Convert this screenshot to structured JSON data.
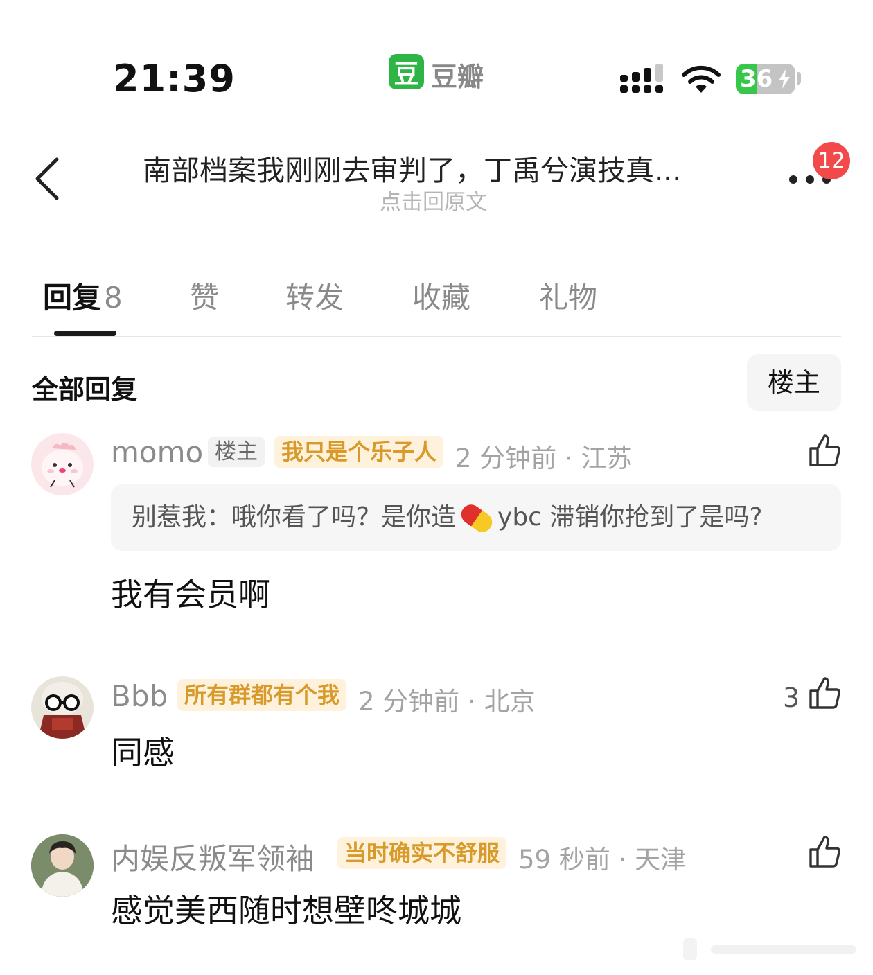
{
  "status_bar": {
    "time": "21:39",
    "app_logo_char": "豆",
    "app_name": "豆瓣",
    "battery": "36",
    "battery_level_percent": 36,
    "icons": [
      "signal-icon",
      "wifi-icon",
      "battery-charging-icon"
    ]
  },
  "nav": {
    "title": "南部档案我刚刚去审判了，丁禹兮演技真...",
    "subtitle": "点击回原文",
    "badge": "12",
    "icons": [
      "back-chevron-icon",
      "more-dots-icon"
    ]
  },
  "tabs": [
    {
      "label": "回复",
      "count": "8",
      "active": true
    },
    {
      "label": "赞"
    },
    {
      "label": "转发"
    },
    {
      "label": "收藏"
    },
    {
      "label": "礼物"
    }
  ],
  "section": {
    "title": "全部回复",
    "filter_label": "楼主"
  },
  "comments": [
    {
      "username": "momo",
      "op_tag": "楼主",
      "group_tag": "我只是个乐子人",
      "meta": "2 分钟前 · 江苏",
      "quote_prefix": "别惹我：哦你看了吗？是你造",
      "quote_suffix": "ybc 滞销你抢到了是吗?",
      "text": "我有会员啊",
      "likes": ""
    },
    {
      "username": "Bbb",
      "group_tag": "所有群都有个我",
      "meta": "2 分钟前 · 北京",
      "text": "同感",
      "likes": "3"
    },
    {
      "username": "内娱反叛军领袖",
      "group_tag": "当时确实不舒服",
      "meta": "59 秒前 · 天津",
      "text": "感觉美西随时想壁咚城城",
      "likes": ""
    }
  ],
  "colors": {
    "brand_green": "#2fb545",
    "badge_red": "#f24a4a",
    "tag_gold_text": "#d89a2a",
    "tag_gold_bg": "#fff2dc"
  }
}
